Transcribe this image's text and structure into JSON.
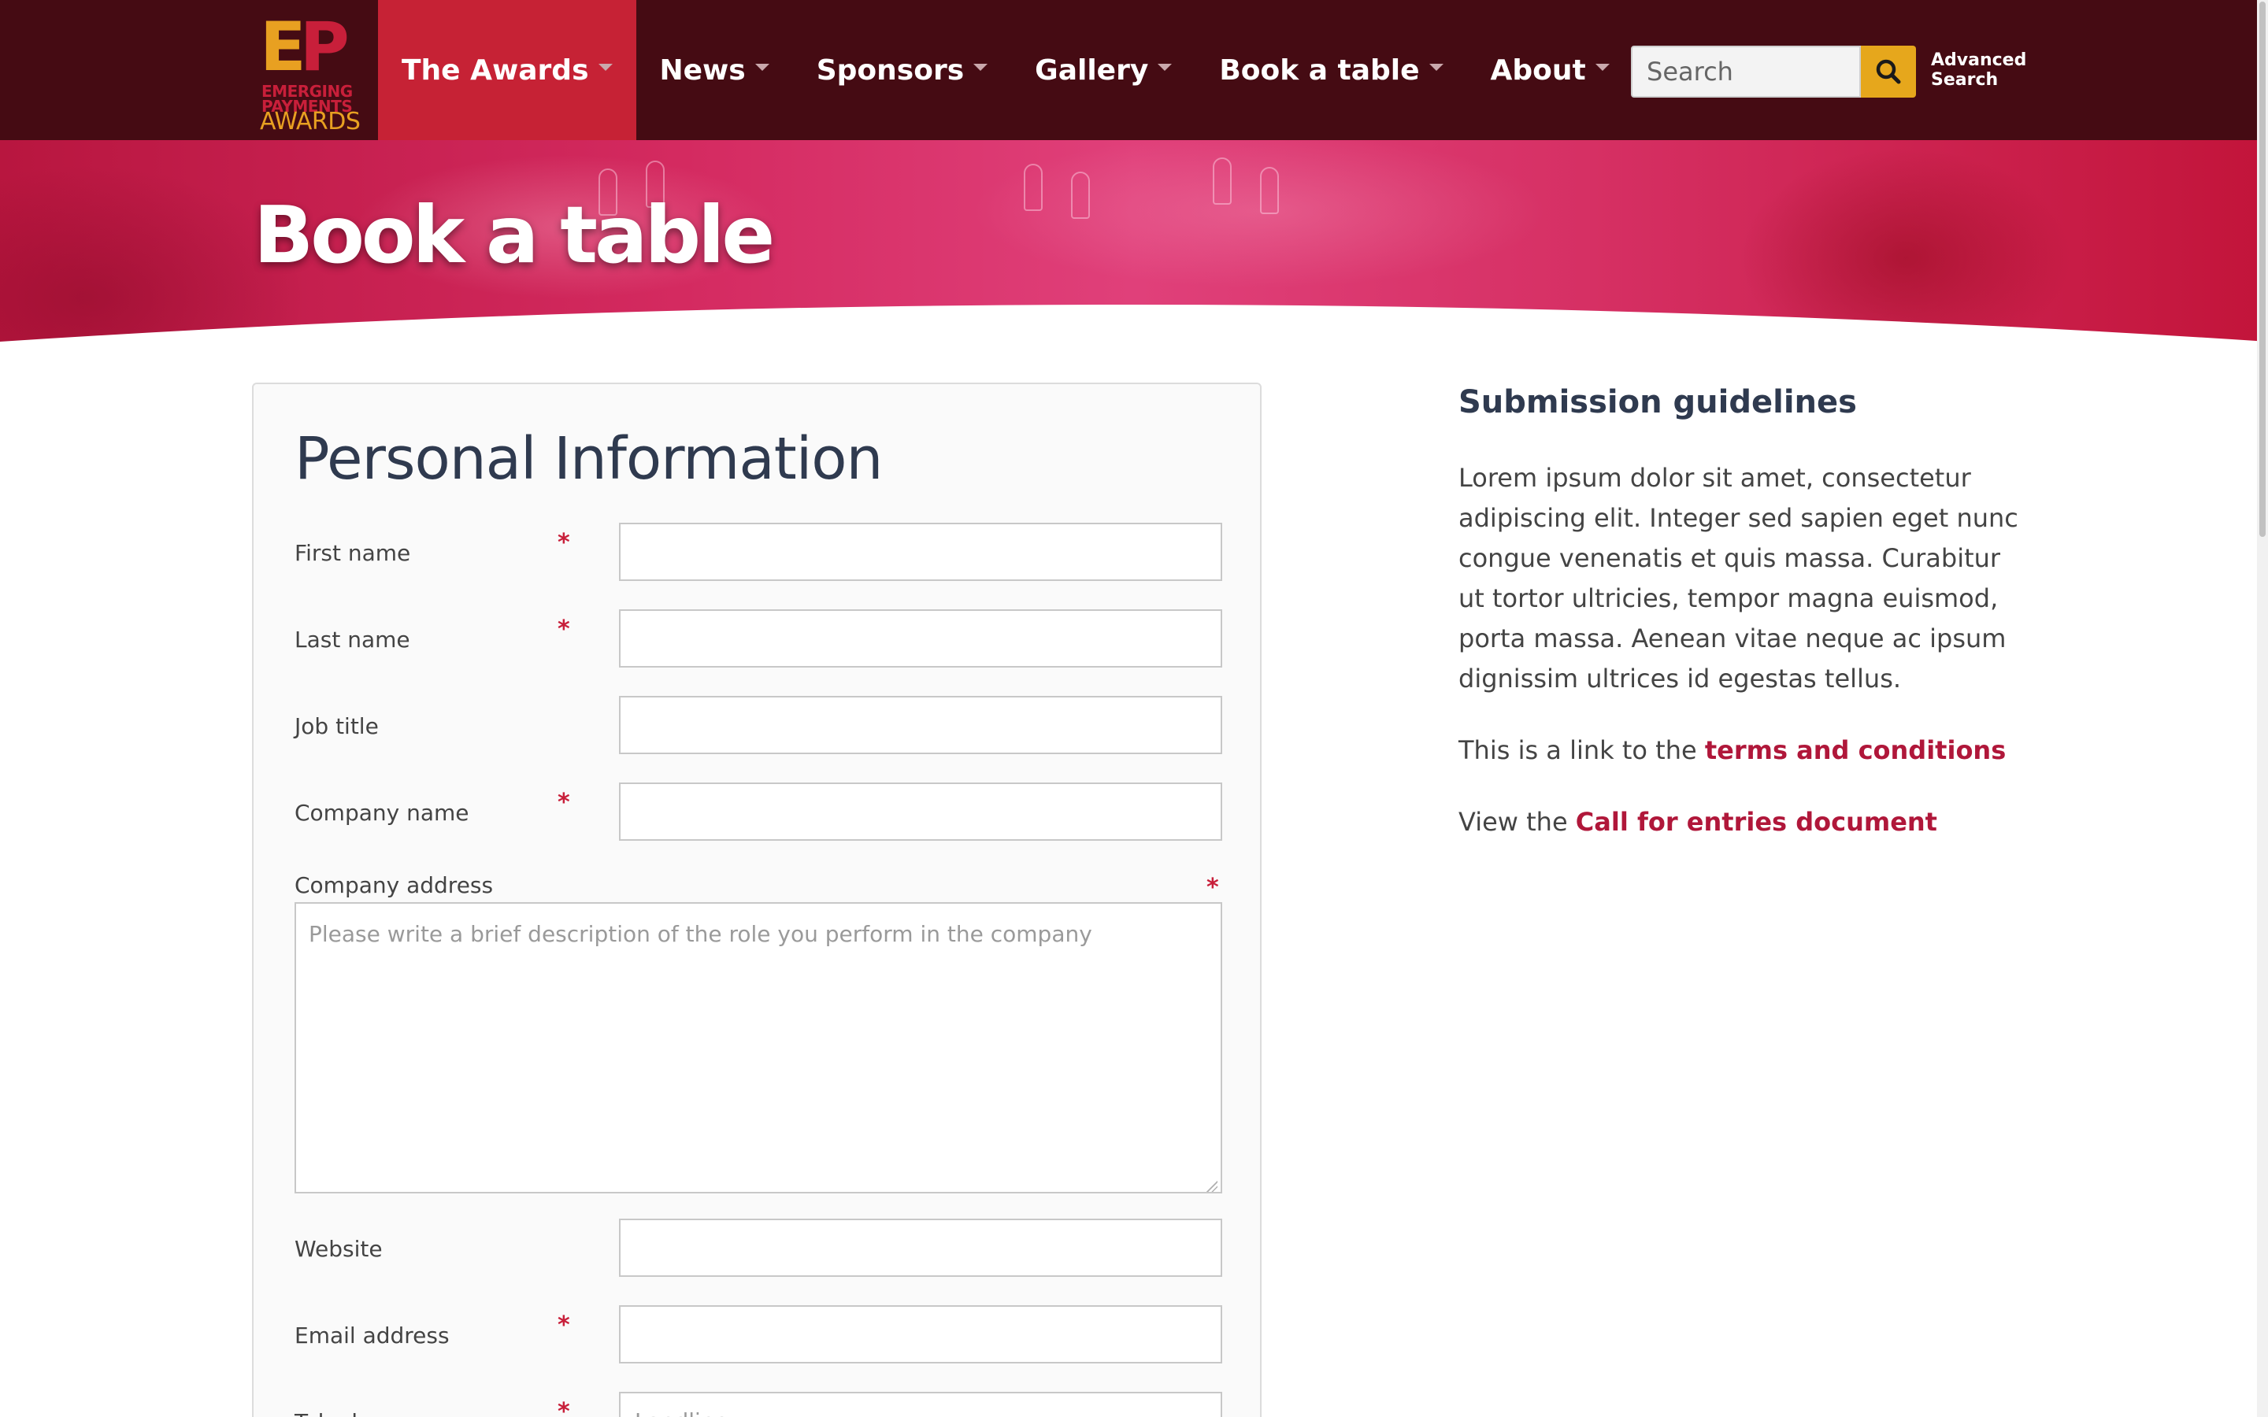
{
  "brand": {
    "logo_mark": "EP",
    "logo_line1": "EMERGING",
    "logo_line2": "PAYMENTS",
    "logo_line3": "AWARDS"
  },
  "nav": {
    "items": [
      {
        "label": "The Awards",
        "active": true
      },
      {
        "label": "News",
        "active": false
      },
      {
        "label": "Sponsors",
        "active": false
      },
      {
        "label": "Gallery",
        "active": false
      },
      {
        "label": "Book a table",
        "active": false
      },
      {
        "label": "About",
        "active": false
      }
    ],
    "search_placeholder": "Search",
    "advanced_line1": "Advanced",
    "advanced_line2": "Search"
  },
  "hero": {
    "title": "Book a table"
  },
  "form": {
    "title": "Personal Information",
    "fields": [
      {
        "label": "First name",
        "required": true,
        "value": ""
      },
      {
        "label": "Last name",
        "required": true,
        "value": ""
      },
      {
        "label": "Job title",
        "required": false,
        "value": ""
      },
      {
        "label": "Company name",
        "required": true,
        "value": ""
      },
      {
        "label": "Company address",
        "required": true,
        "placeholder": "Please write a brief description of the role you perform in the company"
      },
      {
        "label": "Website",
        "required": false,
        "value": ""
      },
      {
        "label": "Email address",
        "required": true,
        "value": ""
      },
      {
        "label": "Telephone",
        "required": true,
        "placeholder": "Landline"
      }
    ],
    "required_mark": "*"
  },
  "sidebar": {
    "title": "Submission guidelines",
    "body": "Lorem ipsum dolor sit amet, consectetur adipiscing elit. Integer sed sapien eget nunc congue venenatis et quis massa. Curabitur ut tortor ultricies, tempor magna euismod, porta massa. Aenean vitae neque ac ipsum dignissim ultrices id egestas tellus.",
    "terms_prefix": "This is a link to the ",
    "terms_link": "terms and conditions",
    "call_prefix": "View the ",
    "call_link": "Call for entries document"
  },
  "colors": {
    "nav_bg": "#450b13",
    "nav_active": "#c62235",
    "search_button": "#e6a71c",
    "link": "#b0173a",
    "required": "#c81f3a"
  }
}
